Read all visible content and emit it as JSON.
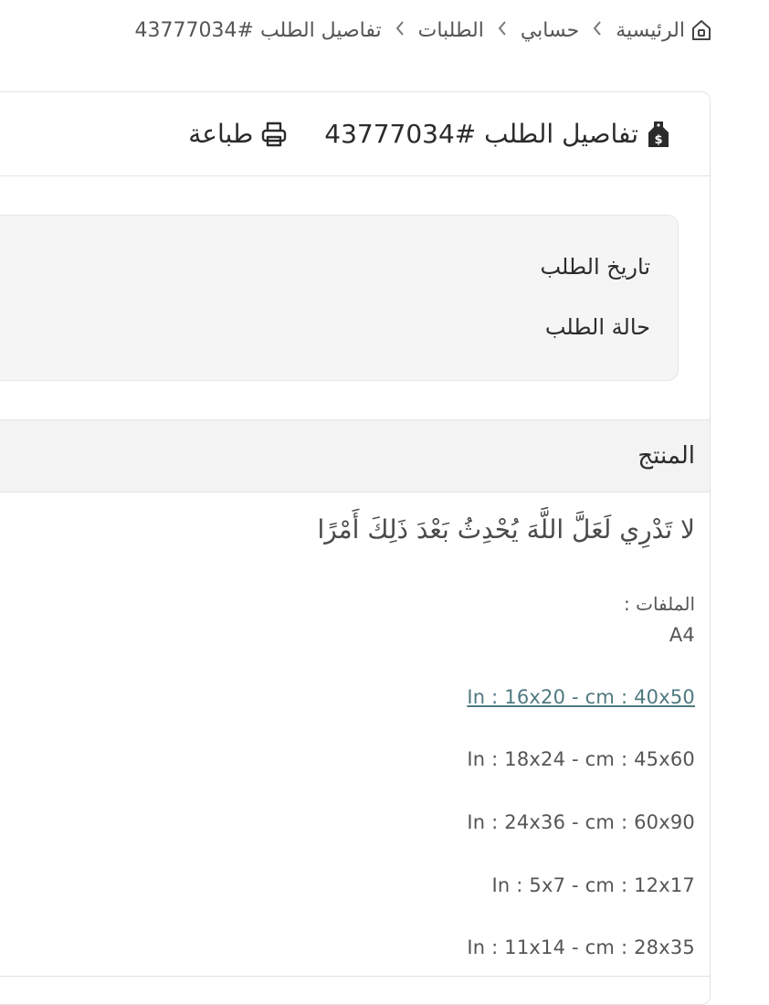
{
  "breadcrumb": {
    "home": "الرئيسية",
    "account": "حسابي",
    "orders": "الطلبات",
    "current": "تفاصيل الطلب #43777034",
    "separator": "<"
  },
  "order_header": {
    "title": "تفاصيل الطلب #43777034",
    "print_label": "طباعة"
  },
  "order_info": {
    "date_label": "تاريخ الطلب",
    "status_label": "حالة الطلب"
  },
  "products": {
    "column_header": "المنتج",
    "item": {
      "name": "لا تَدْرِي لَعَلَّ اللَّهَ يُحْدِثُ بَعْدَ ذَلِكَ أَمْرًا",
      "files_label": "الملفات :",
      "sizes": [
        "A4",
        "In : 16x20 - cm : 40x50",
        "In : 18x24 - cm : 45x60",
        "In : 24x36 - cm : 60x90",
        "In : 5x7 - cm : 12x17",
        "In : 11x14 - cm : 28x35"
      ]
    }
  },
  "icons": {
    "home": "home-icon",
    "order": "money-tag-icon",
    "print": "printer-icon"
  },
  "colors": {
    "link": "#4f7a80",
    "text": "#2b2b2b",
    "muted": "#555555",
    "panel": "#f5f5f5"
  }
}
